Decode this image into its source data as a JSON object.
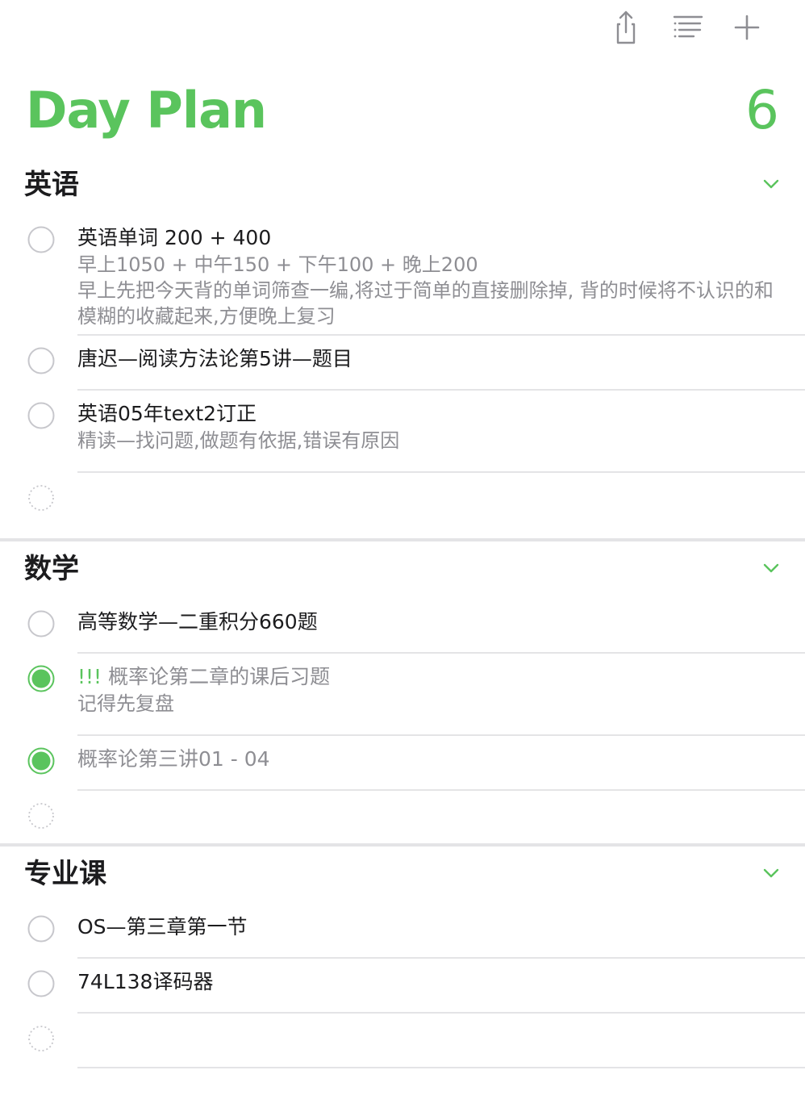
{
  "toolbar": {
    "share_icon": "share-icon",
    "list_icon": "list-icon",
    "add_icon": "plus-icon"
  },
  "list": {
    "title": "Day Plan",
    "count": "6",
    "accent_color": "#5ac45d"
  },
  "sections": [
    {
      "title": "英语",
      "items": [
        {
          "title": "英语单词 200 + 400",
          "notes": [
            "早上1050 + 中午150 + 下午100 +  晚上200",
            "早上先把今天背的单词筛查一编,将过于简单的直接删除掉, 背的时候将不认识的和模糊的收藏起来,方便晚上复习"
          ],
          "completed": false
        },
        {
          "title": "唐迟—阅读方法论第5讲—题目",
          "notes": [],
          "completed": false
        },
        {
          "title": "英语05年text2订正",
          "notes": [
            "精读—找问题,做题有依据,错误有原因"
          ],
          "completed": false
        }
      ]
    },
    {
      "title": "数学",
      "items": [
        {
          "title": "高等数学—二重积分660题",
          "notes": [],
          "completed": false
        },
        {
          "priority": "!!!",
          "title": "概率论第二章的课后习题",
          "notes": [
            "记得先复盘"
          ],
          "completed": true
        },
        {
          "title": "概率论第三讲01 - 04",
          "notes": [],
          "completed": true
        }
      ]
    },
    {
      "title": "专业课",
      "items": [
        {
          "title": "OS—第三章第一节",
          "notes": [],
          "completed": false
        },
        {
          "title": "74L138译码器",
          "notes": [],
          "completed": false
        }
      ]
    }
  ]
}
